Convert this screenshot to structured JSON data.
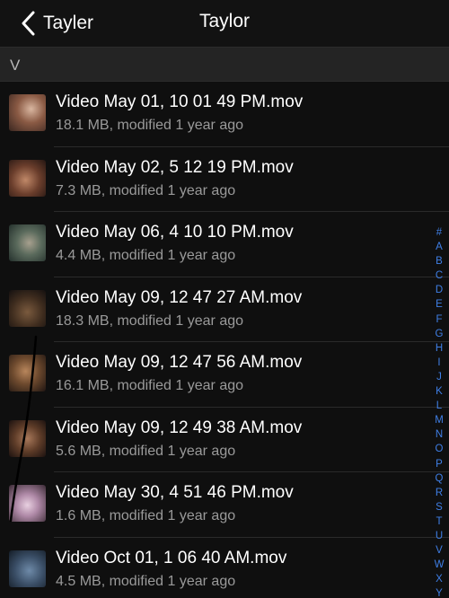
{
  "nav": {
    "back_label": "Tayler",
    "title": "Taylor"
  },
  "section_header": "V",
  "files": [
    {
      "name": "Video May 01, 10 01 49 PM.mov",
      "meta": "18.1 MB, modified 1 year ago"
    },
    {
      "name": "Video May 02, 5 12 19 PM.mov",
      "meta": "7.3 MB, modified 1 year ago"
    },
    {
      "name": "Video May 06, 4 10 10 PM.mov",
      "meta": "4.4 MB, modified 1 year ago"
    },
    {
      "name": "Video May 09, 12 47 27 AM.mov",
      "meta": "18.3 MB, modified 1 year ago"
    },
    {
      "name": "Video May 09, 12 47 56 AM.mov",
      "meta": "16.1 MB, modified 1 year ago"
    },
    {
      "name": "Video May 09, 12 49 38 AM.mov",
      "meta": "5.6 MB, modified 1 year ago"
    },
    {
      "name": "Video May 30, 4 51 46 PM.mov",
      "meta": "1.6 MB, modified 1 year ago"
    },
    {
      "name": "Video Oct 01, 1 06 40 AM.mov",
      "meta": "4.5 MB, modified 1 year ago"
    }
  ],
  "index_letters": [
    "#",
    "A",
    "B",
    "C",
    "D",
    "E",
    "F",
    "G",
    "H",
    "I",
    "J",
    "K",
    "L",
    "M",
    "N",
    "O",
    "P",
    "Q",
    "R",
    "S",
    "T",
    "U",
    "V",
    "W",
    "X",
    "Y"
  ],
  "colors": {
    "accent": "#3f7fe6",
    "background": "#0d0d0d",
    "section": "#242424"
  }
}
